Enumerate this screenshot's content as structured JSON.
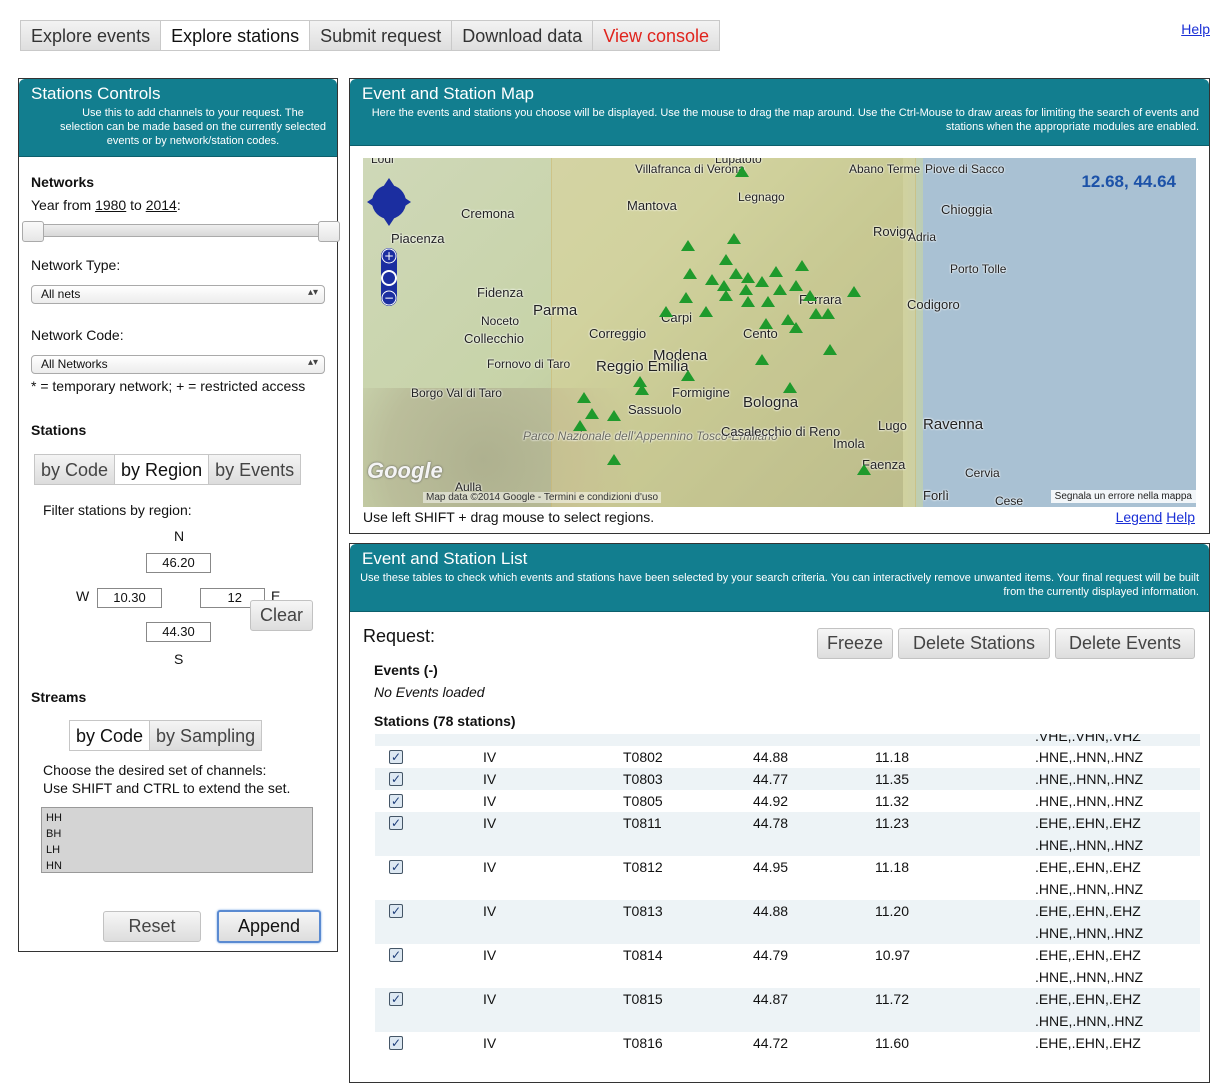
{
  "tabs": [
    {
      "label": "Explore events"
    },
    {
      "label": "Explore stations"
    },
    {
      "label": "Submit request"
    },
    {
      "label": "Download data"
    },
    {
      "label": "View console"
    }
  ],
  "help_link": "Help",
  "stations_controls": {
    "title": "Stations Controls",
    "description": "Use this to add channels to your request. The selection can be made based on the currently selected events or by network/station codes.",
    "networks_heading": "Networks",
    "year_prefix": "Year from",
    "year_from": "1980",
    "year_to_word": "to",
    "year_to": "2014",
    "year_suffix": ":",
    "network_type_label": "Network Type:",
    "network_type_value": "All nets",
    "network_code_label": "Network Code:",
    "network_code_value": "All Networks",
    "network_note": "* = temporary network; + = restricted access",
    "stations_heading": "Stations",
    "station_tabs": [
      "by Code",
      "by Region",
      "by Events"
    ],
    "filter_label": "Filter stations by region:",
    "region": {
      "n_label": "N",
      "s_label": "S",
      "w_label": "W",
      "e_label": "E",
      "north": "46.20",
      "south": "44.30",
      "west": "10.30",
      "east": "12"
    },
    "clear_label": "Clear",
    "streams_heading": "Streams",
    "stream_tabs": [
      "by Code",
      "by Sampling"
    ],
    "channels_hint_1": "Choose the desired set of channels:",
    "channels_hint_2": "Use SHIFT and CTRL to extend the set.",
    "channel_options": [
      "HH",
      "BH",
      "LH",
      "HN"
    ],
    "reset_label": "Reset",
    "append_label": "Append"
  },
  "map_panel": {
    "title": "Event and Station Map",
    "description": "Here the events and stations you choose will be displayed. Use the mouse to drag the map around. Use the Ctrl-Mouse to draw areas for limiting the search of events and stations when the appropriate modules are enabled.",
    "coordinates": "12.68, 44.64",
    "google_mark": "Google",
    "attribution": "Map data ©2014 Google - Termini e condizioni d'uso",
    "report_error": "Segnala un errore nella mappa",
    "hint": "Use left SHIFT + drag mouse to select regions.",
    "legend_link": "Legend",
    "help_link": "Help",
    "towns": [
      "Lodi",
      "Villafranca di Verona",
      "Lupatoto",
      "Abano Terme",
      "Piove di Sacco",
      "Legnago",
      "Cremona",
      "Mantova",
      "Chioggia",
      "Piacenza",
      "Rovigo",
      "Adria",
      "Porto Tolle",
      "Fidenza",
      "Parma",
      "Ferrara",
      "Codigoro",
      "Noceto",
      "Carpi",
      "Collecchio",
      "Correggio",
      "Cento",
      "Fornovo di Taro",
      "Modena",
      "Reggio Emilia",
      "Borgo Val di Taro",
      "Formigine",
      "Bologna",
      "Sassuolo",
      "Lugo",
      "Ravenna",
      "Parco Nazionale dell'Appennino Tosco-Emiliano",
      "Casalecchio di Reno",
      "Imola",
      "Faenza",
      "Cervia",
      "Aulla",
      "Forlì",
      "Cese"
    ]
  },
  "list_panel": {
    "title": "Event and Station List",
    "description": "Use these tables to check which events and stations have been selected by your search criteria. You can interactively remove unwanted items. Your final request will be built from the currently displayed information.",
    "request_label": "Request:",
    "freeze_label": "Freeze",
    "delete_stations_label": "Delete Stations",
    "delete_events_label": "Delete Events",
    "events_heading": "Events (-)",
    "no_events": "No Events loaded",
    "stations_heading": "Stations (78 stations)",
    "partial_top_channels": ".VHE,.VHN,.VHZ",
    "stations": [
      {
        "net": "IV",
        "code": "T0802",
        "lat": "44.88",
        "lon": "11.18",
        "channels": [
          ".HNE,.HNN,.HNZ"
        ]
      },
      {
        "net": "IV",
        "code": "T0803",
        "lat": "44.77",
        "lon": "11.35",
        "channels": [
          ".HNE,.HNN,.HNZ"
        ]
      },
      {
        "net": "IV",
        "code": "T0805",
        "lat": "44.92",
        "lon": "11.32",
        "channels": [
          ".HNE,.HNN,.HNZ"
        ]
      },
      {
        "net": "IV",
        "code": "T0811",
        "lat": "44.78",
        "lon": "11.23",
        "channels": [
          ".EHE,.EHN,.EHZ",
          ".HNE,.HNN,.HNZ"
        ]
      },
      {
        "net": "IV",
        "code": "T0812",
        "lat": "44.95",
        "lon": "11.18",
        "channels": [
          ".EHE,.EHN,.EHZ",
          ".HNE,.HNN,.HNZ"
        ]
      },
      {
        "net": "IV",
        "code": "T0813",
        "lat": "44.88",
        "lon": "11.20",
        "channels": [
          ".EHE,.EHN,.EHZ",
          ".HNE,.HNN,.HNZ"
        ]
      },
      {
        "net": "IV",
        "code": "T0814",
        "lat": "44.79",
        "lon": "10.97",
        "channels": [
          ".EHE,.EHN,.EHZ",
          ".HNE,.HNN,.HNZ"
        ]
      },
      {
        "net": "IV",
        "code": "T0815",
        "lat": "44.87",
        "lon": "11.72",
        "channels": [
          ".EHE,.EHN,.EHZ",
          ".HNE,.HNN,.HNZ"
        ]
      },
      {
        "net": "IV",
        "code": "T0816",
        "lat": "44.72",
        "lon": "11.60",
        "channels": [
          ".EHE,.EHN,.EHZ"
        ]
      }
    ]
  },
  "colors": {
    "panel_header": "#127e8f",
    "station_marker": "#1f9a2c",
    "link": "#1a2fd6",
    "console_tab": "#e0241d",
    "coordinates": "#1c52a8"
  }
}
